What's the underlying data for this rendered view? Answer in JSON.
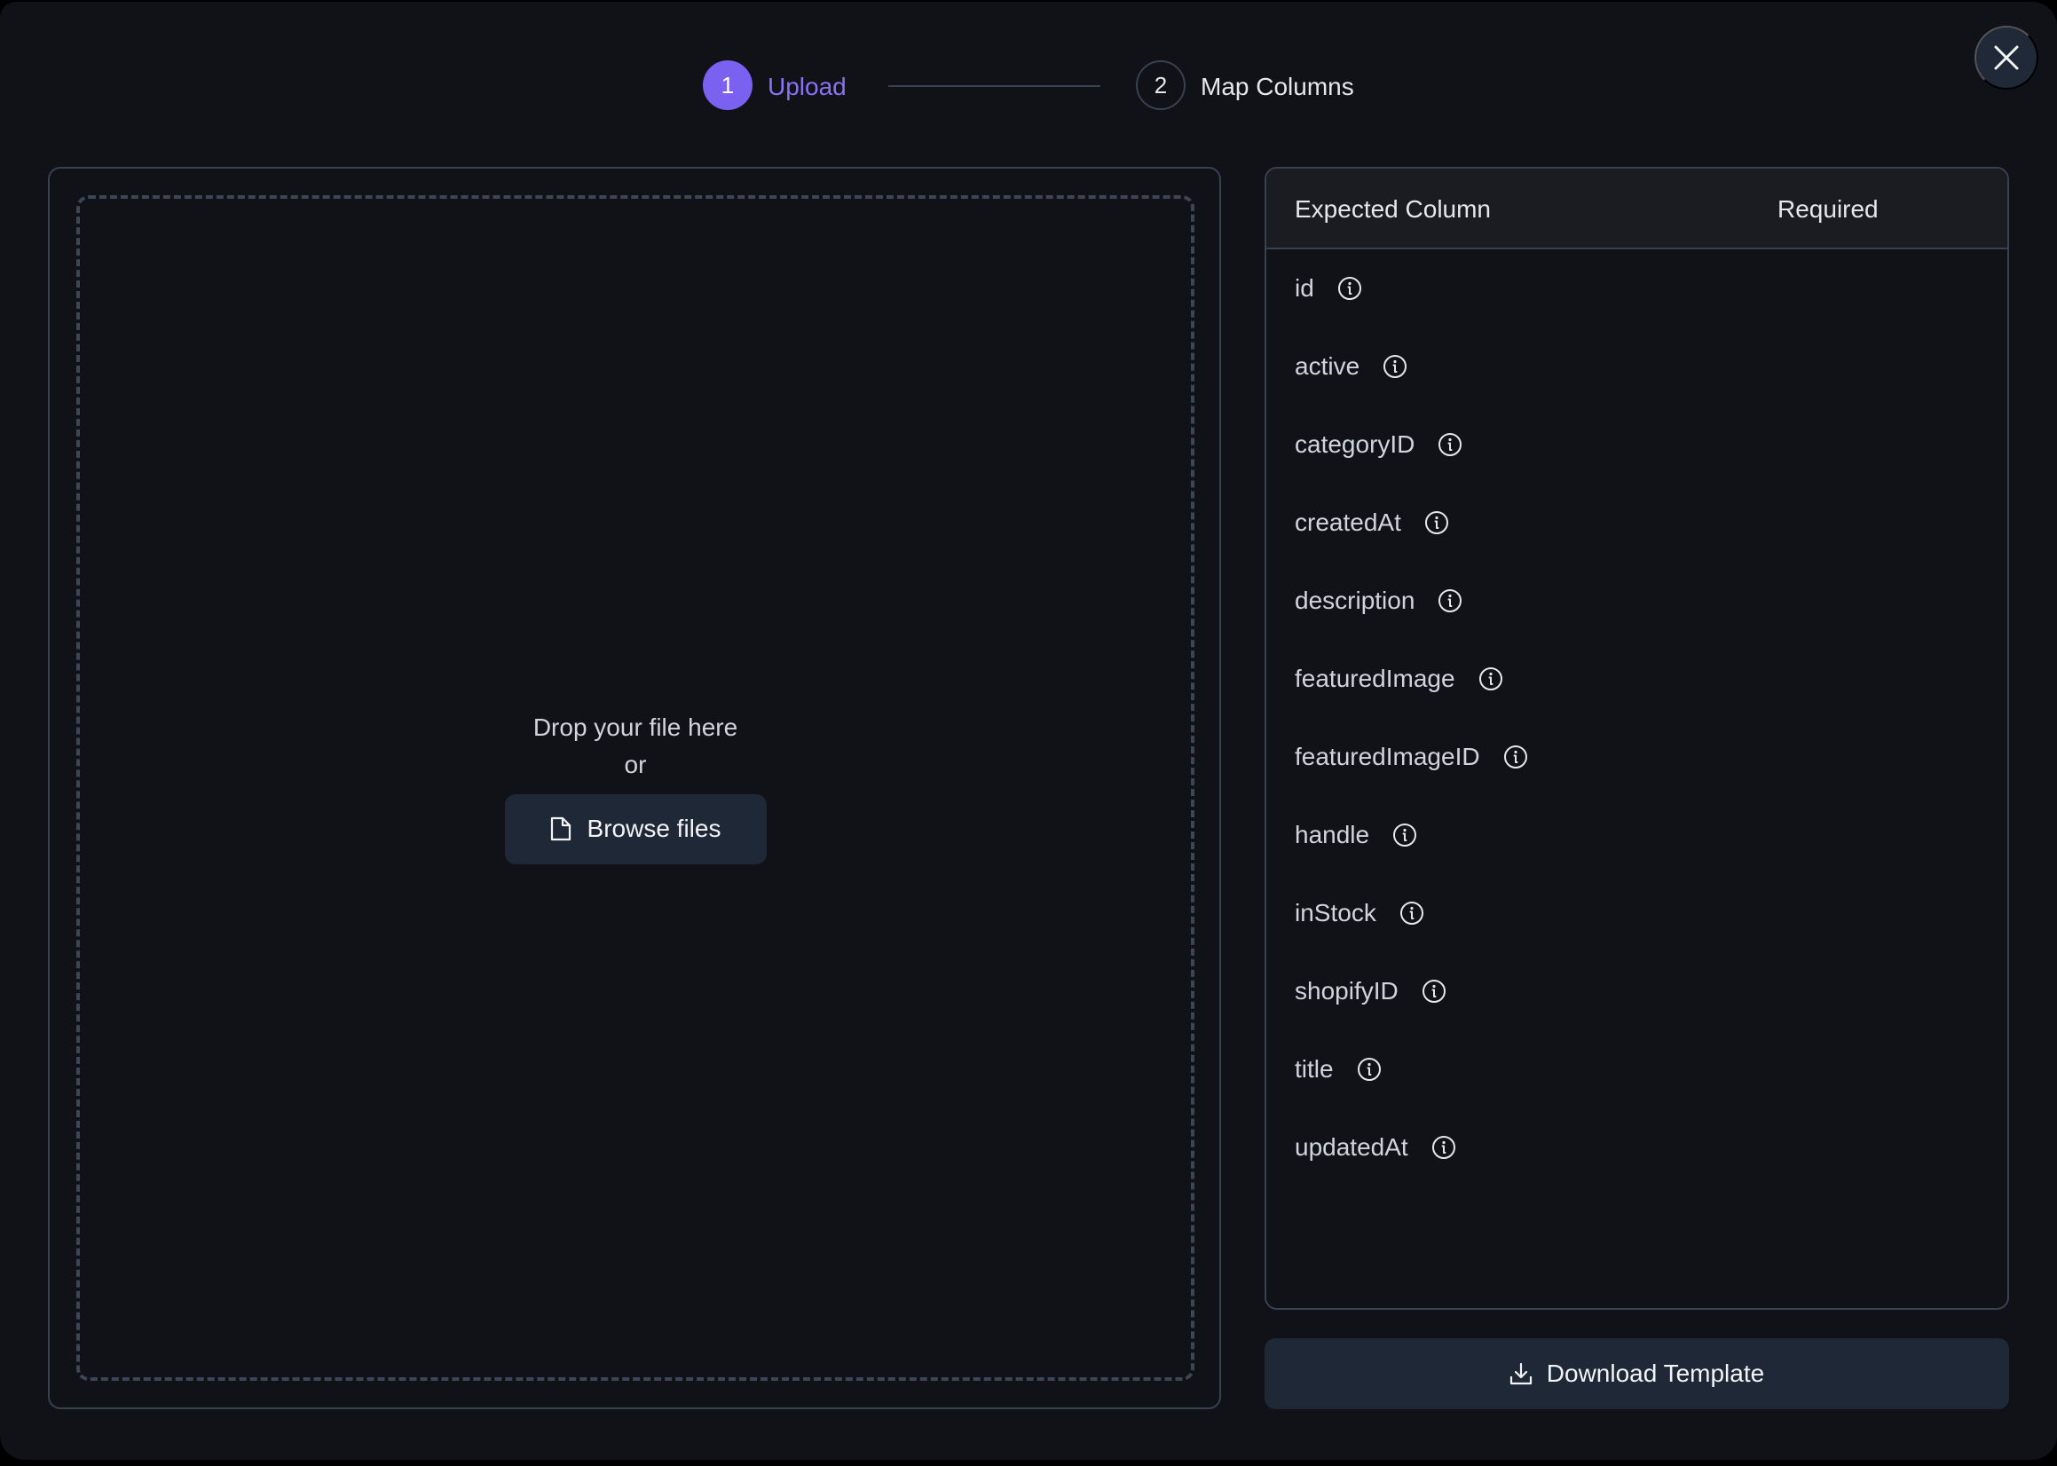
{
  "stepper": {
    "steps": [
      {
        "number": "1",
        "label": "Upload",
        "state": "active"
      },
      {
        "number": "2",
        "label": "Map Columns",
        "state": "inactive"
      }
    ]
  },
  "close": {
    "icon": "close-icon"
  },
  "upload": {
    "drop_text": "Drop your file here",
    "or_text": "or",
    "browse_label": "Browse files",
    "browse_icon": "file-icon"
  },
  "columns_table": {
    "headers": {
      "expected": "Expected Column",
      "required": "Required"
    },
    "rows": [
      {
        "name": "id",
        "required": ""
      },
      {
        "name": "active",
        "required": ""
      },
      {
        "name": "categoryID",
        "required": ""
      },
      {
        "name": "createdAt",
        "required": ""
      },
      {
        "name": "description",
        "required": ""
      },
      {
        "name": "featuredImage",
        "required": ""
      },
      {
        "name": "featuredImageID",
        "required": ""
      },
      {
        "name": "handle",
        "required": ""
      },
      {
        "name": "inStock",
        "required": ""
      },
      {
        "name": "shopifyID",
        "required": ""
      },
      {
        "name": "title",
        "required": ""
      },
      {
        "name": "updatedAt",
        "required": ""
      }
    ],
    "row_icon": "info-icon"
  },
  "download": {
    "label": "Download Template",
    "icon": "download-icon"
  },
  "colors": {
    "accent": "#7b61f0",
    "accent_text": "#8b72f5",
    "background": "#111217",
    "border": "#374151",
    "button_bg": "#1f2837"
  }
}
